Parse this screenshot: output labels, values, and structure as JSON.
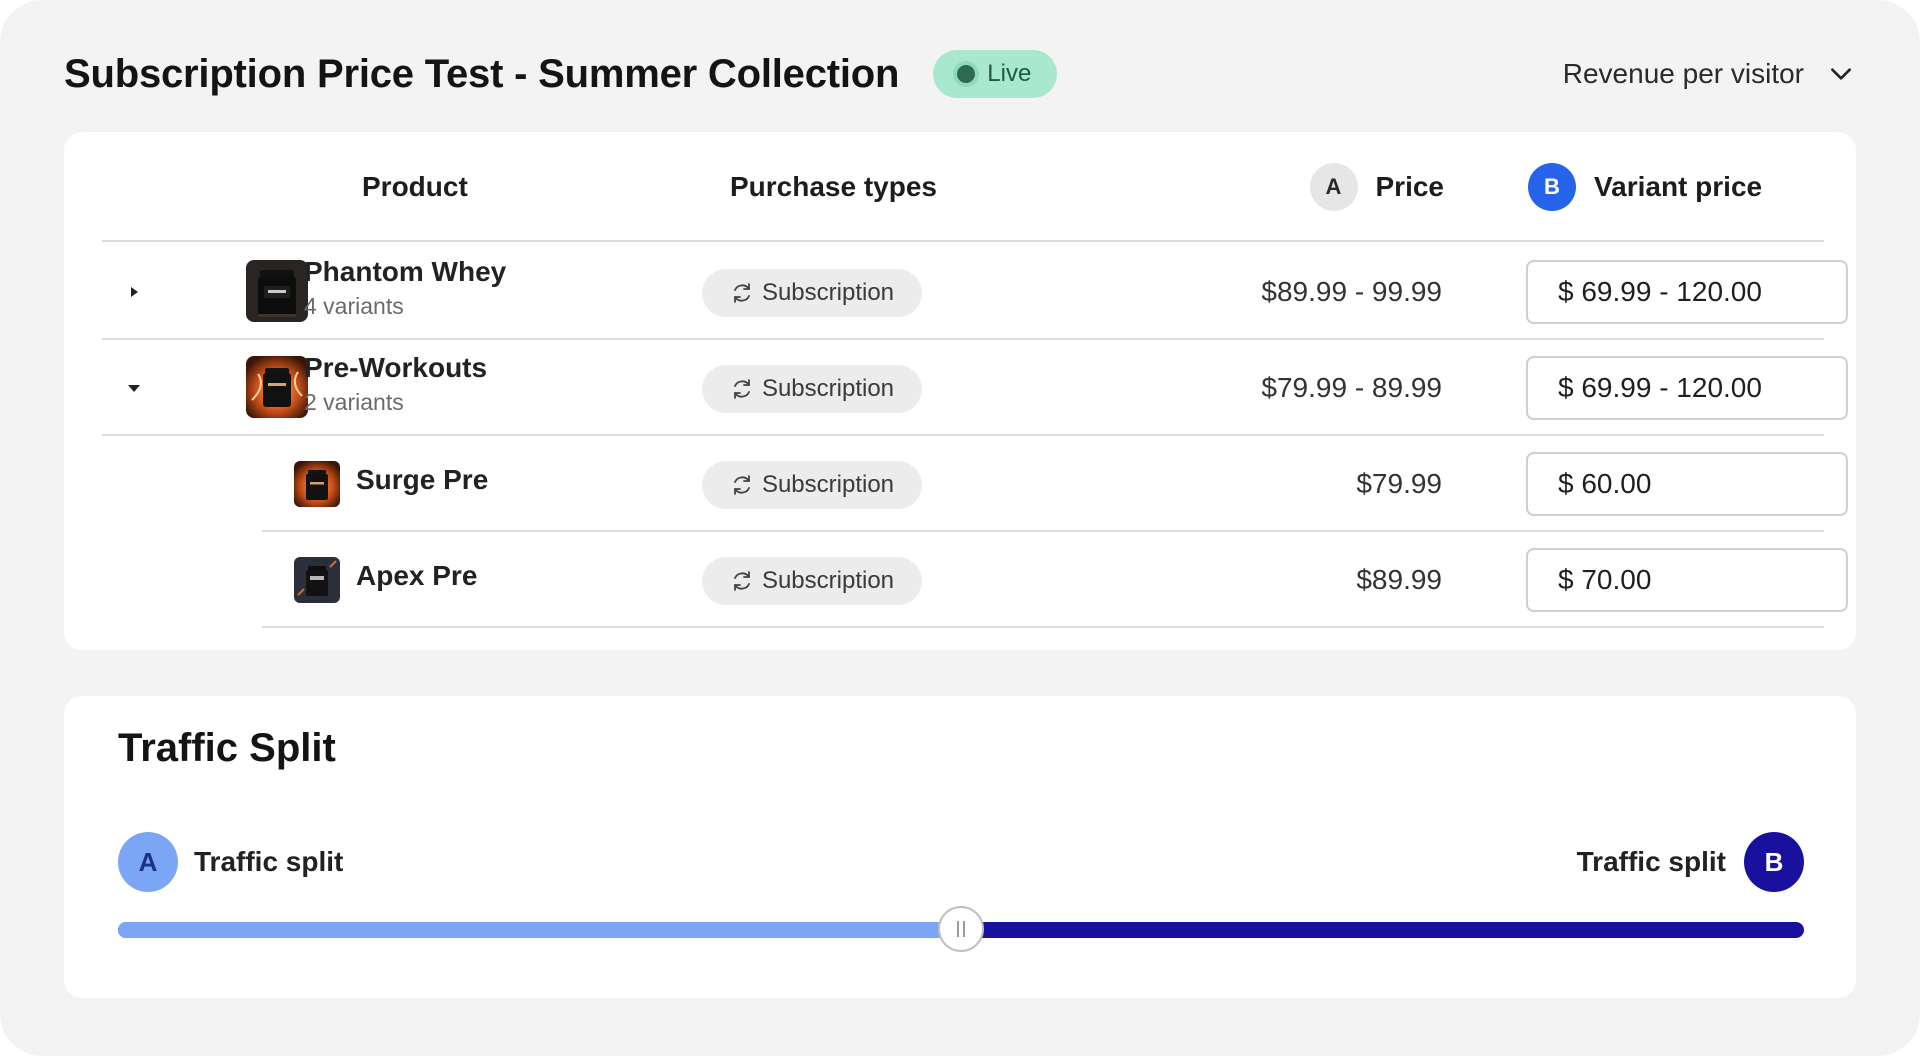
{
  "header": {
    "title": "Subscription Price Test - Summer Collection",
    "status": "Live",
    "metric_selected": "Revenue per visitor"
  },
  "table": {
    "col_product": "Product",
    "col_purchase": "Purchase types",
    "col_price_badge": "A",
    "col_price": "Price",
    "col_variant_badge": "B",
    "col_variant": "Variant price"
  },
  "rows": [
    {
      "name": "Phantom Whey",
      "variants": "4 variants",
      "purchase": "Subscription",
      "price": "$89.99 - 99.99",
      "variant_price": "$ 69.99 - 120.00",
      "expanded": false,
      "thumb": "whey-tub-icon"
    },
    {
      "name": "Pre-Workouts",
      "variants": "2 variants",
      "purchase": "Subscription",
      "price": "$79.99 - 89.99",
      "variant_price": "$ 69.99 - 120.00",
      "expanded": true,
      "thumb": "preworkout-tub-icon"
    }
  ],
  "subrows": [
    {
      "name": "Surge Pre",
      "purchase": "Subscription",
      "price": "$79.99",
      "variant_price": "$ 60.00",
      "thumb": "surge-tub-icon"
    },
    {
      "name": "Apex Pre",
      "purchase": "Subscription",
      "price": "$89.99",
      "variant_price": "$ 70.00",
      "thumb": "apex-tub-icon"
    }
  ],
  "traffic": {
    "title": "Traffic Split",
    "label_a": "Traffic split",
    "badge_a": "A",
    "label_b": "Traffic split",
    "badge_b": "B",
    "split_a_fraction": 0.5,
    "color_a": "#7ba6f5",
    "color_b": "#1a109e"
  }
}
